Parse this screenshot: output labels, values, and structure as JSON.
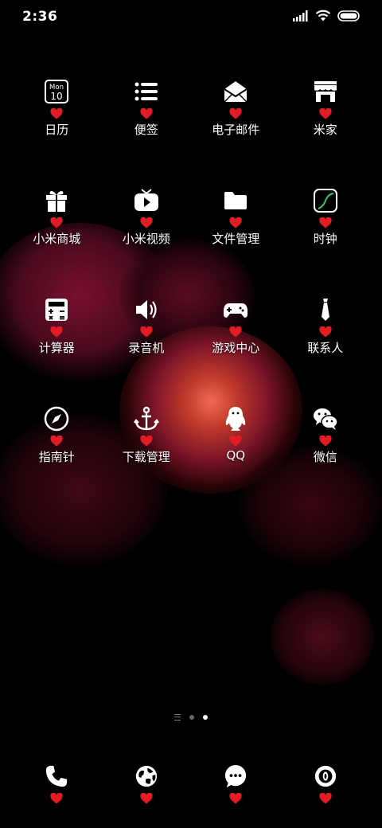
{
  "status_bar": {
    "time": "2:36",
    "icons": [
      "signal-icon",
      "wifi-icon",
      "battery-icon"
    ]
  },
  "apps": [
    {
      "label": "日历",
      "icon": "calendar-icon",
      "calendar_month": "Mon",
      "calendar_day": "10"
    },
    {
      "label": "便签",
      "icon": "notes-list-icon"
    },
    {
      "label": "电子邮件",
      "icon": "mail-icon"
    },
    {
      "label": "米家",
      "icon": "store-icon"
    },
    {
      "label": "小米商城",
      "icon": "gift-icon"
    },
    {
      "label": "小米视频",
      "icon": "video-play-icon"
    },
    {
      "label": "文件管理",
      "icon": "folder-icon"
    },
    {
      "label": "时钟",
      "icon": "clock-chart-icon"
    },
    {
      "label": "计算器",
      "icon": "calculator-icon"
    },
    {
      "label": "录音机",
      "icon": "speaker-icon"
    },
    {
      "label": "游戏中心",
      "icon": "gamepad-icon"
    },
    {
      "label": "联系人",
      "icon": "tie-icon"
    },
    {
      "label": "指南针",
      "icon": "compass-icon"
    },
    {
      "label": "下载管理",
      "icon": "anchor-icon"
    },
    {
      "label": "QQ",
      "icon": "penguin-icon"
    },
    {
      "label": "微信",
      "icon": "wechat-icon"
    }
  ],
  "page_indicator": {
    "pages": 2,
    "active_page": 2
  },
  "dock": [
    {
      "icon": "phone-icon"
    },
    {
      "icon": "globe-icon"
    },
    {
      "icon": "message-bubble-icon"
    },
    {
      "icon": "camera-lens-icon"
    }
  ],
  "colors": {
    "heart": "#e31b23",
    "background": "#000000",
    "label": "#ffffff"
  }
}
